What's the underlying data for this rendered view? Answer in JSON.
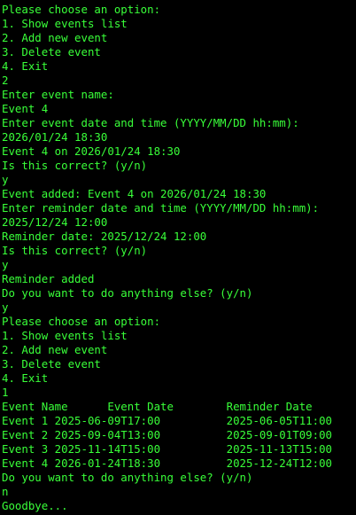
{
  "terminal": {
    "text_color": "#39ff39",
    "background_color": "#000000",
    "lines": [
      "Please choose an option:",
      "1. Show events list",
      "2. Add new event",
      "3. Delete event",
      "4. Exit",
      "2",
      "Enter event name:",
      "Event 4",
      "Enter event date and time (YYYY/MM/DD hh:mm):",
      "2026/01/24 18:30",
      "Event 4 on 2026/01/24 18:30",
      "Is this correct? (y/n)",
      "y",
      "Event added: Event 4 on 2026/01/24 18:30",
      "Enter reminder date and time (YYYY/MM/DD hh:mm):",
      "2025/12/24 12:00",
      "Reminder date: 2025/12/24 12:00",
      "Is this correct? (y/n)",
      "y",
      "Reminder added",
      "Do you want to do anything else? (y/n)",
      "y",
      "Please choose an option:",
      "1. Show events list",
      "2. Add new event",
      "3. Delete event",
      "4. Exit",
      "1",
      "Event Name      Event Date        Reminder Date",
      "Event 1 2025-06-09T17:00          2025-06-05T11:00",
      "Event 2 2025-09-04T13:00          2025-09-01T09:00",
      "Event 3 2025-11-14T15:00          2025-11-13T15:00",
      "Event 4 2026-01-24T18:30          2025-12-24T12:00",
      "Do you want to do anything else? (y/n)",
      "n",
      "Goodbye..."
    ]
  }
}
